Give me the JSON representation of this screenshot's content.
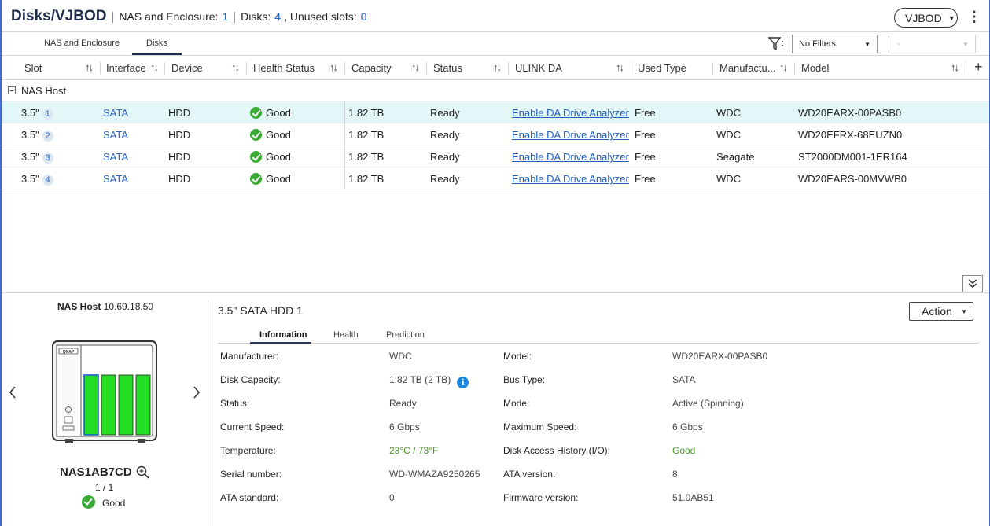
{
  "header": {
    "title": "Disks/VJBOD",
    "nas_label": "NAS and Enclosure:",
    "nas_count": "1",
    "disks_label": "Disks:",
    "disks_count": "4",
    "unused_label": ", Unused slots:",
    "unused_count": "0",
    "selector": "VJBOD"
  },
  "tabs": [
    {
      "label": "NAS and Enclosure"
    },
    {
      "label": "Disks",
      "active": true
    }
  ],
  "filter": {
    "filter_value": "No Filters",
    "secondary_value": "-"
  },
  "table": {
    "columns": [
      "Slot",
      "Interface",
      "Device",
      "Health Status",
      "Capacity",
      "Status",
      "ULINK DA",
      "Used Type",
      "Manufactu...",
      "Model"
    ],
    "group": "NAS Host",
    "rows": [
      {
        "slot": "3.5\"",
        "slot_no": "1",
        "interface": "SATA",
        "device": "HDD",
        "health": "Good",
        "capacity": "1.82 TB",
        "status": "Ready",
        "ulink": "Enable DA Drive Analyzer",
        "used_type": "Free",
        "manufacturer": "WDC",
        "model": "WD20EARX-00PASB0"
      },
      {
        "slot": "3.5\"",
        "slot_no": "2",
        "interface": "SATA",
        "device": "HDD",
        "health": "Good",
        "capacity": "1.82 TB",
        "status": "Ready",
        "ulink": "Enable DA Drive Analyzer",
        "used_type": "Free",
        "manufacturer": "WDC",
        "model": "WD20EFRX-68EUZN0"
      },
      {
        "slot": "3.5\"",
        "slot_no": "3",
        "interface": "SATA",
        "device": "HDD",
        "health": "Good",
        "capacity": "1.82 TB",
        "status": "Ready",
        "ulink": "Enable DA Drive Analyzer",
        "used_type": "Free",
        "manufacturer": "Seagate",
        "model": "ST2000DM001-1ER164"
      },
      {
        "slot": "3.5\"",
        "slot_no": "4",
        "interface": "SATA",
        "device": "HDD",
        "health": "Good",
        "capacity": "1.82 TB",
        "status": "Ready",
        "ulink": "Enable DA Drive Analyzer",
        "used_type": "Free",
        "manufacturer": "WDC",
        "model": "WD20EARS-00MVWB0"
      }
    ]
  },
  "device_panel": {
    "host_label": "NAS Host",
    "host_ip": "10.69.18.50",
    "brand": "QNAP",
    "name": "NAS1AB7CD",
    "count": "1 / 1",
    "status": "Good"
  },
  "details": {
    "title": "3.5\" SATA HDD 1",
    "action": "Action",
    "tabs": [
      "Information",
      "Health",
      "Prediction"
    ],
    "left": [
      {
        "label": "Manufacturer:",
        "value": "WDC"
      },
      {
        "label": "Disk Capacity:",
        "value": "1.82 TB (2 TB)"
      },
      {
        "label": "Status:",
        "value": "Ready"
      },
      {
        "label": "Current Speed:",
        "value": "6 Gbps"
      },
      {
        "label": "Temperature:",
        "value": "23°C / 73°F"
      },
      {
        "label": "Serial number:",
        "value": "WD-WMAZA9250265"
      },
      {
        "label": "ATA standard:",
        "value": "0"
      }
    ],
    "right": [
      {
        "label": "Model:",
        "value": "WD20EARX-00PASB0"
      },
      {
        "label": "Bus Type:",
        "value": "SATA"
      },
      {
        "label": "Mode:",
        "value": "Active (Spinning)"
      },
      {
        "label": "Maximum Speed:",
        "value": "6 Gbps"
      },
      {
        "label": "Disk Access History (I/O):",
        "value": "Good"
      },
      {
        "label": "ATA version:",
        "value": "8"
      },
      {
        "label": "Firmware version:",
        "value": "51.0AB51"
      }
    ]
  },
  "colors": {
    "accent": "#2b66c4",
    "good": "#3aaa35",
    "selected_row": "#e4f7f8",
    "drive_green": "#22dd22"
  }
}
